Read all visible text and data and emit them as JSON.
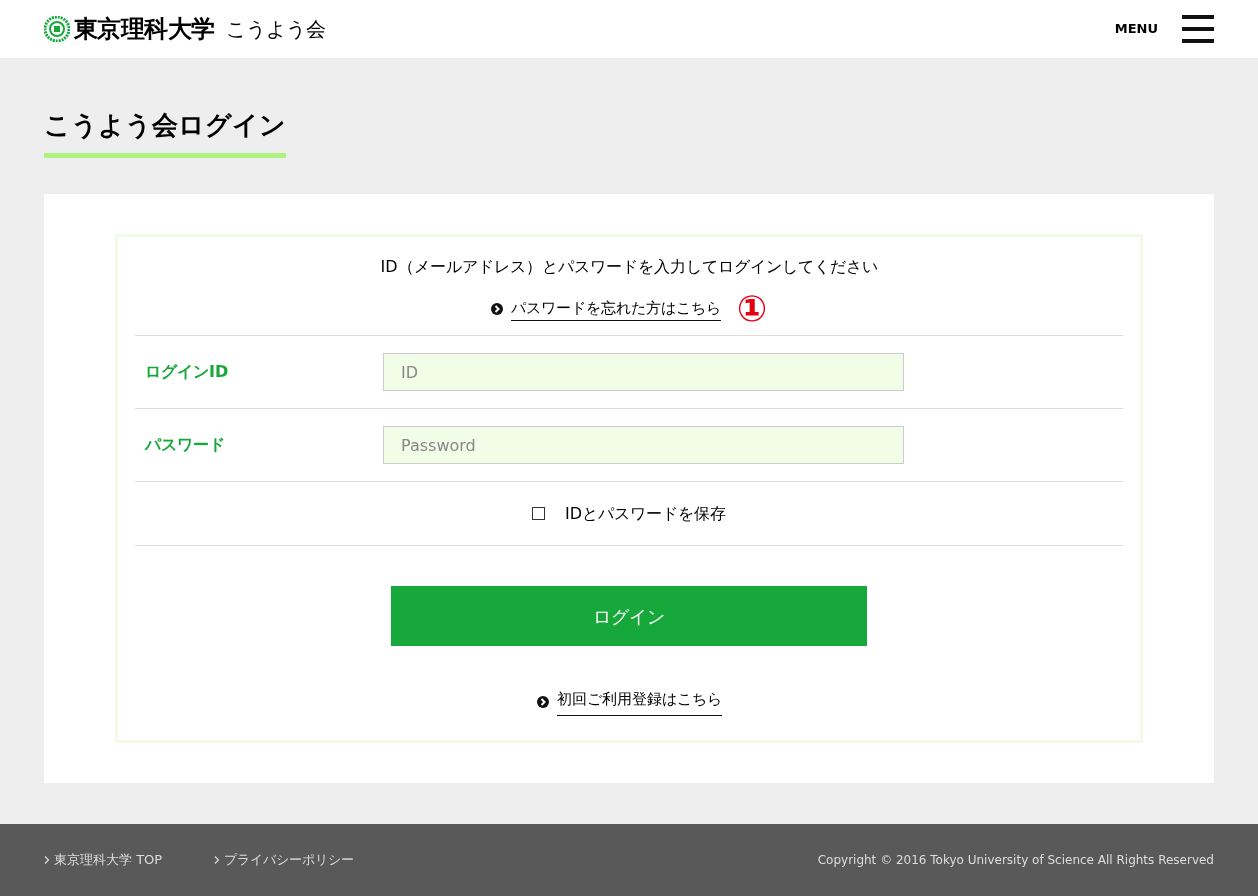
{
  "header": {
    "logo_text": "東京理科大学",
    "site_name": "こうよう会",
    "menu_label": "MENU"
  },
  "page_title": "こうよう会ログイン",
  "login": {
    "instruction": "ID（メールアドレス）とパスワードを入力してログインしてください",
    "forgot_link": "パスワードを忘れた方はこちら",
    "annotation": "①",
    "fields": [
      {
        "label": "ログインID",
        "placeholder": "ID"
      },
      {
        "label": "パスワード",
        "placeholder": "Password"
      }
    ],
    "remember": {
      "label": "IDとパスワードを保存",
      "checked": false
    },
    "submit": "ログイン",
    "register_link": "初回ご利用登録はこちら"
  },
  "footer": {
    "links": [
      "東京理科大学 TOP",
      "プライバシーポリシー"
    ],
    "copyright": "Copyright © 2016 Tokyo University of Science All Rights Reserved"
  }
}
